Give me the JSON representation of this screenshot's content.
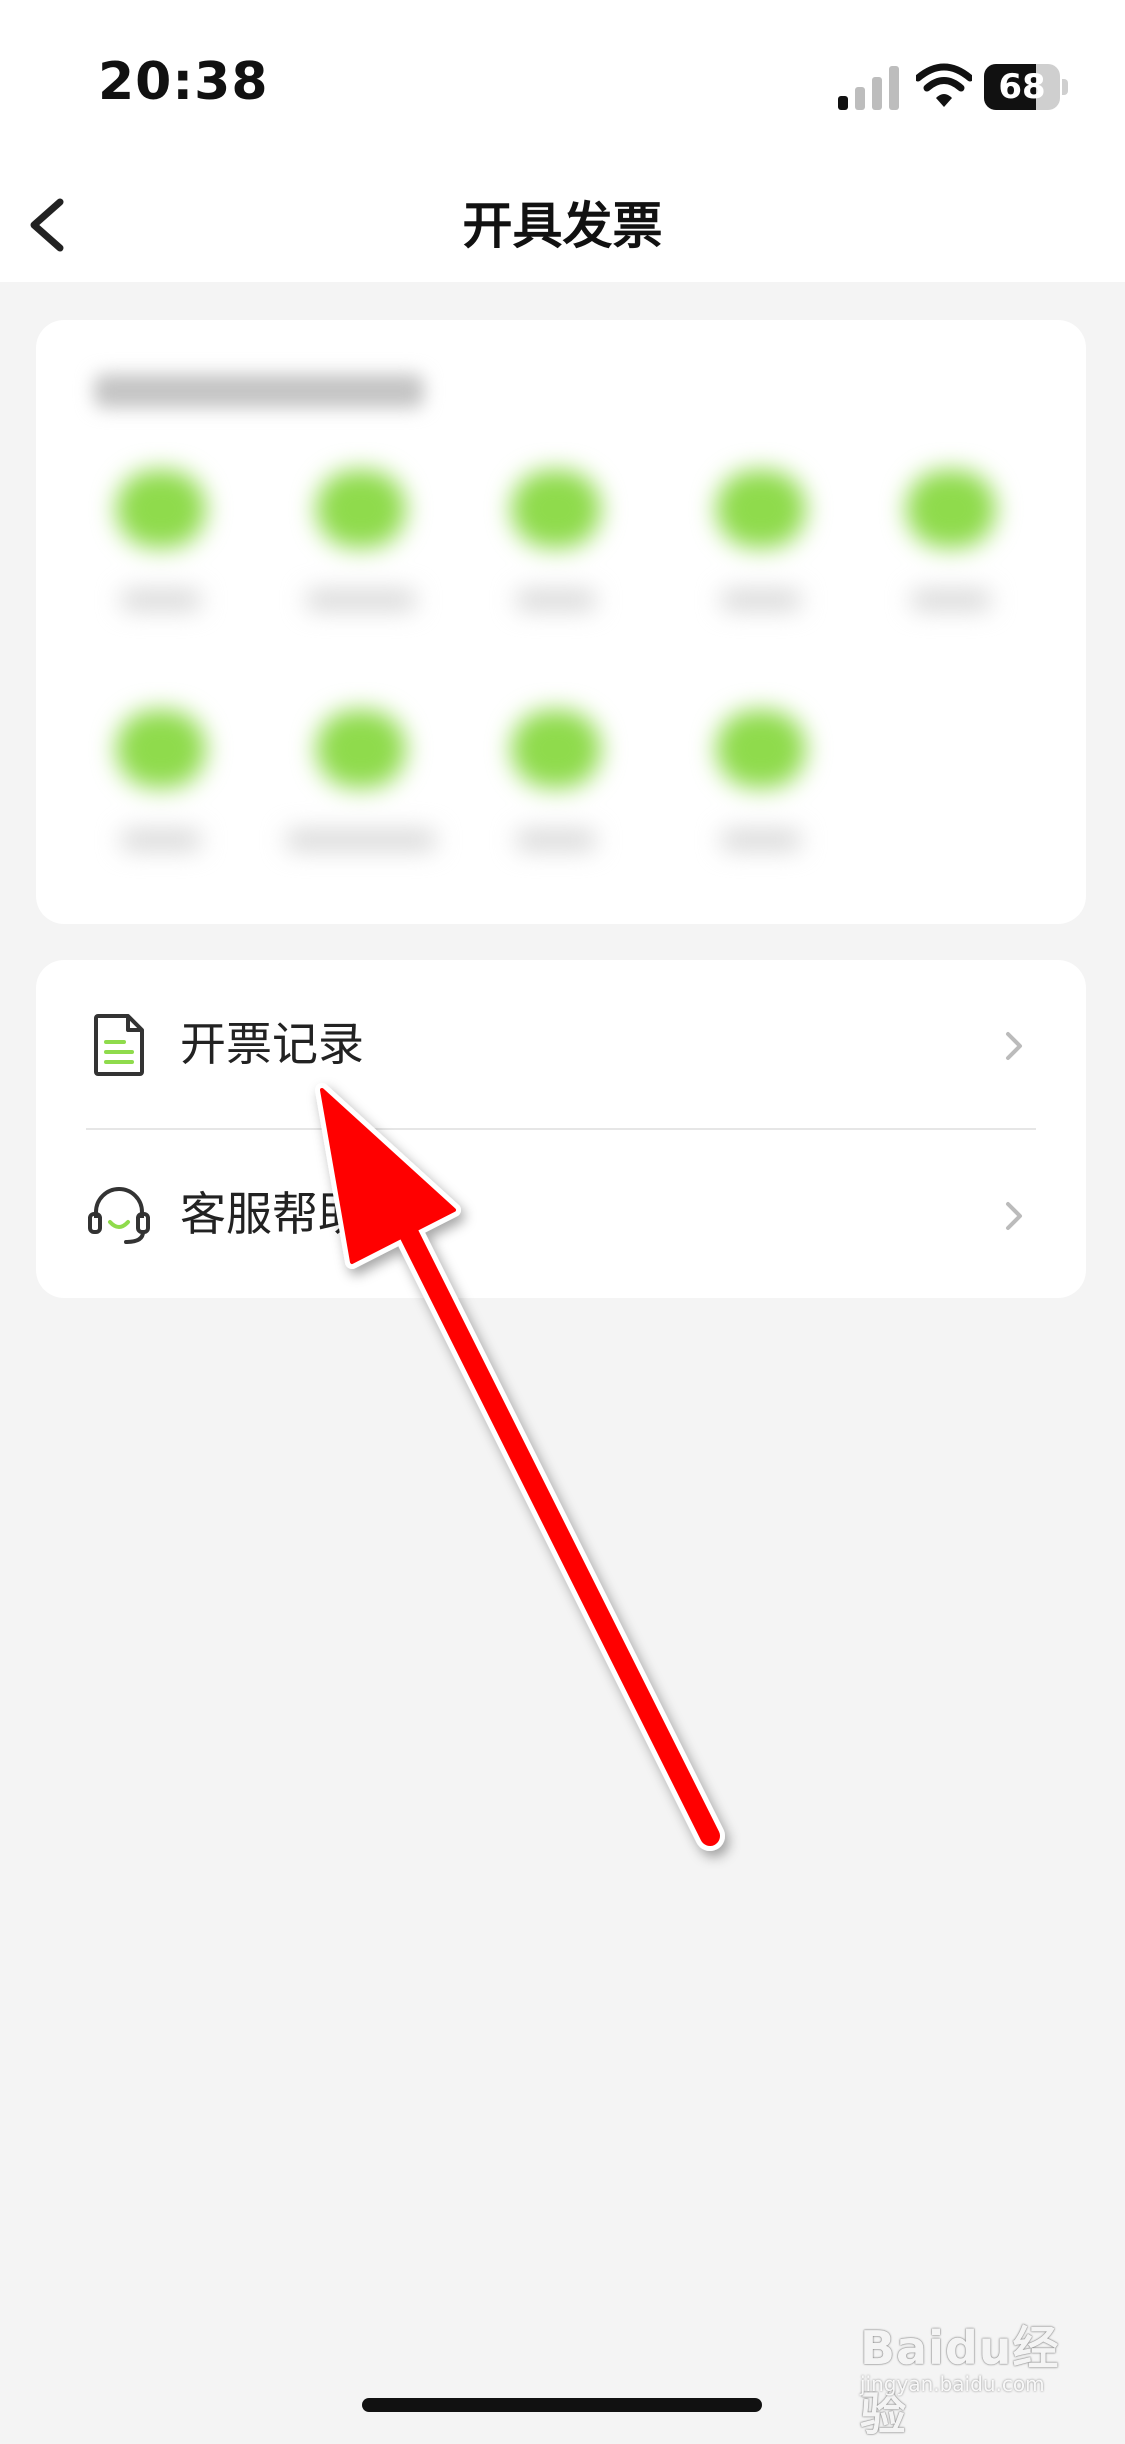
{
  "status_bar": {
    "time": "20:38",
    "battery_percent": 68,
    "battery_label": "68"
  },
  "nav": {
    "title": "开具发票",
    "back_icon": "chevron-left-icon"
  },
  "services": {
    "blurred": true,
    "rows": [
      5,
      4
    ]
  },
  "menu": {
    "items": [
      {
        "label": "开票记录",
        "icon": "document-icon"
      },
      {
        "label": "客服帮助",
        "icon": "headset-icon"
      }
    ]
  },
  "colors": {
    "accent_green": "#8fdb4c",
    "annotation_red": "#ff0000",
    "background": "#f4f4f4"
  },
  "watermark": {
    "brand": "Baidu经验",
    "url": "jingyan.baidu.com"
  }
}
